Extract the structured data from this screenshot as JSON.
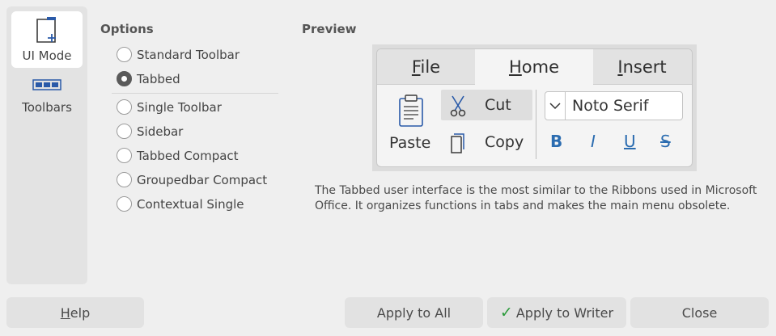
{
  "sidebar": {
    "ui_mode_label": "UI Mode",
    "toolbars_label": "Toolbars"
  },
  "options": {
    "title": "Options",
    "items": [
      {
        "label": "Standard Toolbar",
        "checked": false
      },
      {
        "label": "Tabbed",
        "checked": true
      },
      {
        "label": "Single Toolbar",
        "checked": false
      },
      {
        "label": "Sidebar",
        "checked": false
      },
      {
        "label": "Tabbed Compact",
        "checked": false
      },
      {
        "label": "Groupedbar Compact",
        "checked": false
      },
      {
        "label": "Contextual Single",
        "checked": false
      }
    ]
  },
  "preview": {
    "title": "Preview",
    "tabs": {
      "file_u": "F",
      "file_rest": "ile",
      "home_u": "H",
      "home_rest": "ome",
      "insert_u": "I",
      "insert_rest": "nsert"
    },
    "paste": "Paste",
    "cut": "Cut",
    "copy": "Copy",
    "font": "Noto Serif",
    "bold": "B",
    "italic": "I",
    "underline": "U",
    "strike": "S",
    "description": "The Tabbed user interface is the most similar to the Ribbons used in Microsoft Office. It organizes functions in tabs and makes the main menu obsolete."
  },
  "buttons": {
    "help_u": "H",
    "help_rest": "elp",
    "apply_all": "Apply to All",
    "apply_writer": "Apply to Writer",
    "close": "Close"
  },
  "colors": {
    "accent_check": "#2a9a3a",
    "format_blue": "#2b6cb0",
    "icon_blue": "#2a5aa8"
  }
}
